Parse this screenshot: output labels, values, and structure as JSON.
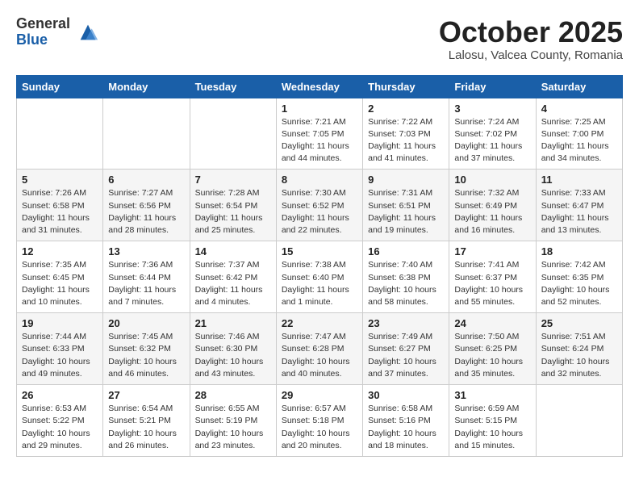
{
  "logo": {
    "general": "General",
    "blue": "Blue"
  },
  "header": {
    "month": "October 2025",
    "location": "Lalosu, Valcea County, Romania"
  },
  "weekdays": [
    "Sunday",
    "Monday",
    "Tuesday",
    "Wednesday",
    "Thursday",
    "Friday",
    "Saturday"
  ],
  "weeks": [
    [
      {
        "day": "",
        "info": ""
      },
      {
        "day": "",
        "info": ""
      },
      {
        "day": "",
        "info": ""
      },
      {
        "day": "1",
        "info": "Sunrise: 7:21 AM\nSunset: 7:05 PM\nDaylight: 11 hours and 44 minutes."
      },
      {
        "day": "2",
        "info": "Sunrise: 7:22 AM\nSunset: 7:03 PM\nDaylight: 11 hours and 41 minutes."
      },
      {
        "day": "3",
        "info": "Sunrise: 7:24 AM\nSunset: 7:02 PM\nDaylight: 11 hours and 37 minutes."
      },
      {
        "day": "4",
        "info": "Sunrise: 7:25 AM\nSunset: 7:00 PM\nDaylight: 11 hours and 34 minutes."
      }
    ],
    [
      {
        "day": "5",
        "info": "Sunrise: 7:26 AM\nSunset: 6:58 PM\nDaylight: 11 hours and 31 minutes."
      },
      {
        "day": "6",
        "info": "Sunrise: 7:27 AM\nSunset: 6:56 PM\nDaylight: 11 hours and 28 minutes."
      },
      {
        "day": "7",
        "info": "Sunrise: 7:28 AM\nSunset: 6:54 PM\nDaylight: 11 hours and 25 minutes."
      },
      {
        "day": "8",
        "info": "Sunrise: 7:30 AM\nSunset: 6:52 PM\nDaylight: 11 hours and 22 minutes."
      },
      {
        "day": "9",
        "info": "Sunrise: 7:31 AM\nSunset: 6:51 PM\nDaylight: 11 hours and 19 minutes."
      },
      {
        "day": "10",
        "info": "Sunrise: 7:32 AM\nSunset: 6:49 PM\nDaylight: 11 hours and 16 minutes."
      },
      {
        "day": "11",
        "info": "Sunrise: 7:33 AM\nSunset: 6:47 PM\nDaylight: 11 hours and 13 minutes."
      }
    ],
    [
      {
        "day": "12",
        "info": "Sunrise: 7:35 AM\nSunset: 6:45 PM\nDaylight: 11 hours and 10 minutes."
      },
      {
        "day": "13",
        "info": "Sunrise: 7:36 AM\nSunset: 6:44 PM\nDaylight: 11 hours and 7 minutes."
      },
      {
        "day": "14",
        "info": "Sunrise: 7:37 AM\nSunset: 6:42 PM\nDaylight: 11 hours and 4 minutes."
      },
      {
        "day": "15",
        "info": "Sunrise: 7:38 AM\nSunset: 6:40 PM\nDaylight: 11 hours and 1 minute."
      },
      {
        "day": "16",
        "info": "Sunrise: 7:40 AM\nSunset: 6:38 PM\nDaylight: 10 hours and 58 minutes."
      },
      {
        "day": "17",
        "info": "Sunrise: 7:41 AM\nSunset: 6:37 PM\nDaylight: 10 hours and 55 minutes."
      },
      {
        "day": "18",
        "info": "Sunrise: 7:42 AM\nSunset: 6:35 PM\nDaylight: 10 hours and 52 minutes."
      }
    ],
    [
      {
        "day": "19",
        "info": "Sunrise: 7:44 AM\nSunset: 6:33 PM\nDaylight: 10 hours and 49 minutes."
      },
      {
        "day": "20",
        "info": "Sunrise: 7:45 AM\nSunset: 6:32 PM\nDaylight: 10 hours and 46 minutes."
      },
      {
        "day": "21",
        "info": "Sunrise: 7:46 AM\nSunset: 6:30 PM\nDaylight: 10 hours and 43 minutes."
      },
      {
        "day": "22",
        "info": "Sunrise: 7:47 AM\nSunset: 6:28 PM\nDaylight: 10 hours and 40 minutes."
      },
      {
        "day": "23",
        "info": "Sunrise: 7:49 AM\nSunset: 6:27 PM\nDaylight: 10 hours and 37 minutes."
      },
      {
        "day": "24",
        "info": "Sunrise: 7:50 AM\nSunset: 6:25 PM\nDaylight: 10 hours and 35 minutes."
      },
      {
        "day": "25",
        "info": "Sunrise: 7:51 AM\nSunset: 6:24 PM\nDaylight: 10 hours and 32 minutes."
      }
    ],
    [
      {
        "day": "26",
        "info": "Sunrise: 6:53 AM\nSunset: 5:22 PM\nDaylight: 10 hours and 29 minutes."
      },
      {
        "day": "27",
        "info": "Sunrise: 6:54 AM\nSunset: 5:21 PM\nDaylight: 10 hours and 26 minutes."
      },
      {
        "day": "28",
        "info": "Sunrise: 6:55 AM\nSunset: 5:19 PM\nDaylight: 10 hours and 23 minutes."
      },
      {
        "day": "29",
        "info": "Sunrise: 6:57 AM\nSunset: 5:18 PM\nDaylight: 10 hours and 20 minutes."
      },
      {
        "day": "30",
        "info": "Sunrise: 6:58 AM\nSunset: 5:16 PM\nDaylight: 10 hours and 18 minutes."
      },
      {
        "day": "31",
        "info": "Sunrise: 6:59 AM\nSunset: 5:15 PM\nDaylight: 10 hours and 15 minutes."
      },
      {
        "day": "",
        "info": ""
      }
    ]
  ]
}
